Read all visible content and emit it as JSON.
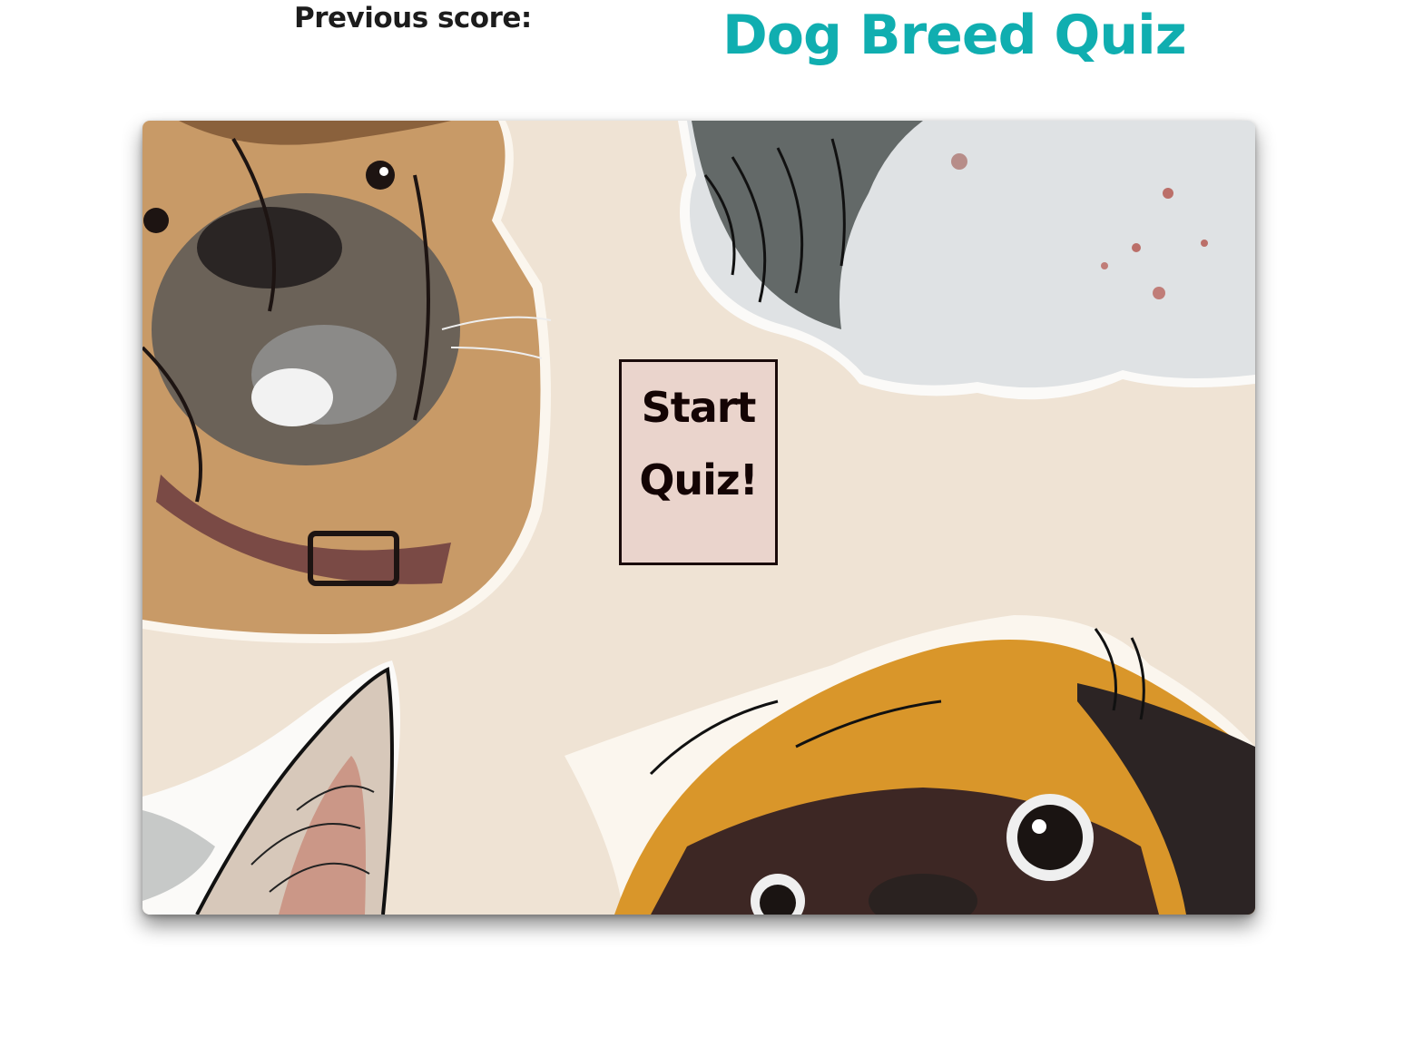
{
  "header": {
    "previous_score_label": "Previous score:",
    "previous_score_value": "",
    "title": "Dog Breed Quiz"
  },
  "quiz": {
    "start_button_line1": "Start",
    "start_button_line2": "Quiz!"
  },
  "colors": {
    "title": "#10aeb0",
    "board_background": "#efe3d4",
    "button_background": "#ead4cc",
    "button_border": "#1a0a0a"
  },
  "illustrations": [
    "boxer-dog-icon",
    "shaggy-white-dog-icon",
    "pug-dog-icon",
    "dog-ear-icon"
  ]
}
